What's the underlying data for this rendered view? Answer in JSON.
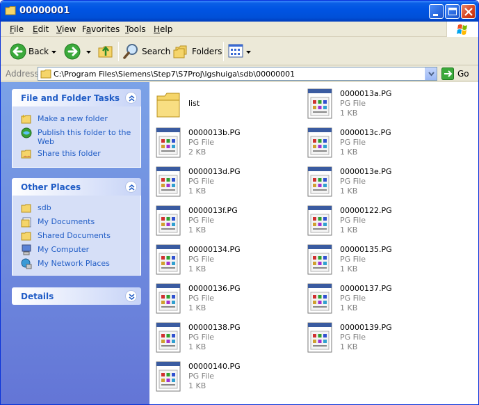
{
  "window": {
    "title": "00000001"
  },
  "menu": [
    "File",
    "Edit",
    "View",
    "Favorites",
    "Tools",
    "Help"
  ],
  "menu_underline": [
    "F",
    "E",
    "V",
    "a",
    "T",
    "H"
  ],
  "toolbar": {
    "back": "Back",
    "search": "Search",
    "folders": "Folders"
  },
  "address": {
    "label": "Address",
    "path": "C:\\Program Files\\Siemens\\Step7\\S7Proj\\lgshuiga\\sdb\\00000001",
    "go": "Go"
  },
  "left": {
    "tasks": {
      "title": "File and Folder Tasks",
      "items": [
        "Make a new folder",
        "Publish this folder to the Web",
        "Share this folder"
      ]
    },
    "places": {
      "title": "Other Places",
      "items": [
        "sdb",
        "My Documents",
        "Shared Documents",
        "My Computer",
        "My Network Places"
      ]
    },
    "details": {
      "title": "Details"
    }
  },
  "files": [
    {
      "name": "list",
      "type": "",
      "size": "",
      "kind": "folder"
    },
    {
      "name": "0000013a.PG",
      "type": "PG File",
      "size": "1 KB",
      "kind": "pg"
    },
    {
      "name": "0000013b.PG",
      "type": "PG File",
      "size": "2 KB",
      "kind": "pg"
    },
    {
      "name": "0000013c.PG",
      "type": "PG File",
      "size": "1 KB",
      "kind": "pg"
    },
    {
      "name": "0000013d.PG",
      "type": "PG File",
      "size": "1 KB",
      "kind": "pg"
    },
    {
      "name": "0000013e.PG",
      "type": "PG File",
      "size": "1 KB",
      "kind": "pg"
    },
    {
      "name": "0000013f.PG",
      "type": "PG File",
      "size": "1 KB",
      "kind": "pg"
    },
    {
      "name": "00000122.PG",
      "type": "PG File",
      "size": "1 KB",
      "kind": "pg"
    },
    {
      "name": "00000134.PG",
      "type": "PG File",
      "size": "1 KB",
      "kind": "pg"
    },
    {
      "name": "00000135.PG",
      "type": "PG File",
      "size": "1 KB",
      "kind": "pg"
    },
    {
      "name": "00000136.PG",
      "type": "PG File",
      "size": "1 KB",
      "kind": "pg"
    },
    {
      "name": "00000137.PG",
      "type": "PG File",
      "size": "1 KB",
      "kind": "pg"
    },
    {
      "name": "00000138.PG",
      "type": "PG File",
      "size": "1 KB",
      "kind": "pg"
    },
    {
      "name": "00000139.PG",
      "type": "PG File",
      "size": "1 KB",
      "kind": "pg"
    },
    {
      "name": "00000140.PG",
      "type": "PG File",
      "size": "1 KB",
      "kind": "pg"
    }
  ],
  "colors": {
    "titlebar": "#0054e3",
    "task_link": "#215dc6",
    "pane_top": "#7ba2e7",
    "pane_bottom": "#6375d6"
  }
}
